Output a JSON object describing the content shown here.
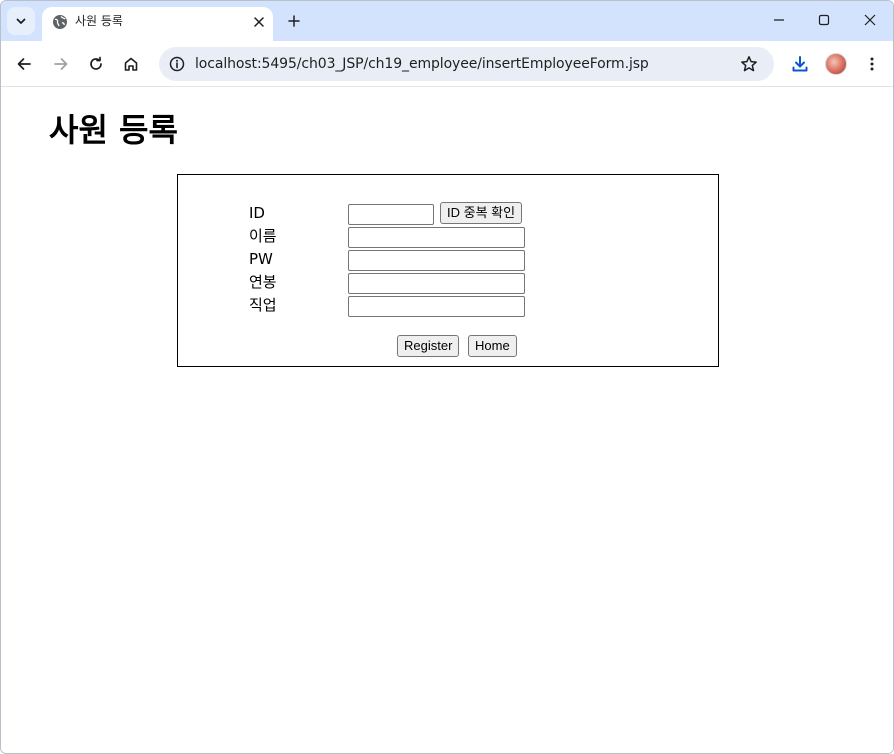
{
  "browser": {
    "tab_title": "사원 등록",
    "url": "localhost:5495/ch03_JSP/ch19_employee/insertEmployeeForm.jsp",
    "icons": {
      "tab_search": "chevron-down-icon",
      "favicon": "globe-icon",
      "tab_close": "close-icon",
      "new_tab": "plus-icon",
      "minimize": "minimize-icon",
      "maximize": "maximize-icon",
      "close_window": "close-icon",
      "back": "back-arrow-icon",
      "forward": "forward-arrow-icon",
      "reload": "reload-icon",
      "home": "home-icon",
      "site_info": "info-icon",
      "bookmark": "star-icon",
      "download": "download-icon",
      "profile": "avatar",
      "menu": "kebab-menu-icon"
    },
    "colors": {
      "tabstrip": "#d3e3fd",
      "omnibox": "#e9eef6",
      "download_accent": "#0b57d0"
    }
  },
  "page": {
    "title": "사원 등록",
    "form": {
      "fields": [
        {
          "label": "ID",
          "value": ""
        },
        {
          "label": "이름",
          "value": ""
        },
        {
          "label": "PW",
          "value": ""
        },
        {
          "label": "연봉",
          "value": ""
        },
        {
          "label": "직업",
          "value": ""
        }
      ],
      "id_check_button": "ID 중복 확인",
      "register_button": "Register",
      "home_button": "Home"
    }
  }
}
